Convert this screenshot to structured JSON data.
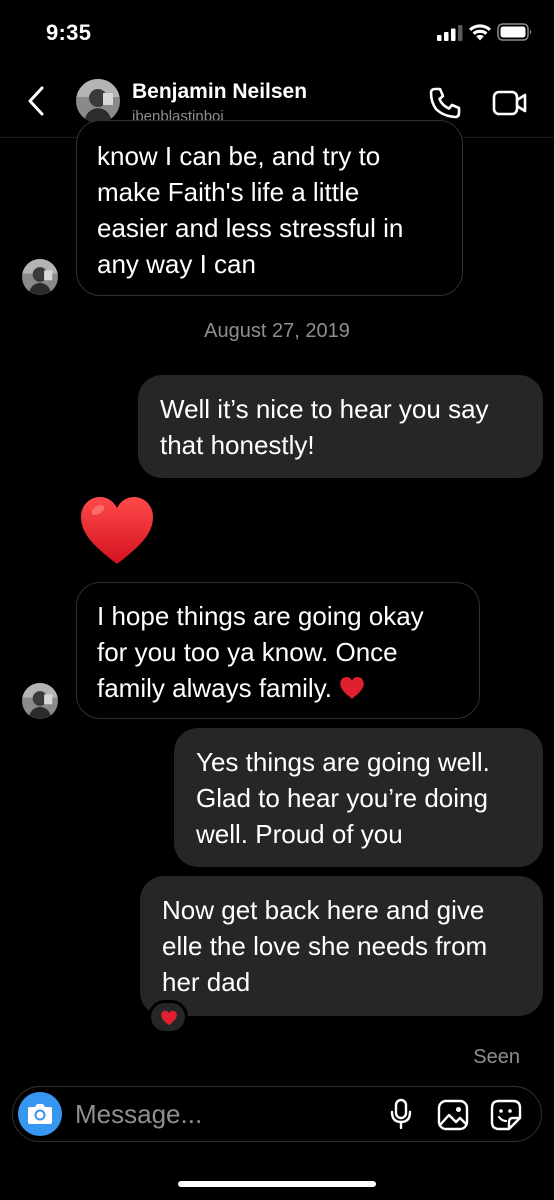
{
  "status_bar": {
    "time": "9:35"
  },
  "header": {
    "contact_name": "Benjamin Neilsen",
    "contact_handle": "ibenblastinboi"
  },
  "messages": [
    {
      "direction": "incoming",
      "text": "know I can be, and try to\nmake Faith's life a little\neasier and less stressful in\nany way I can"
    },
    {
      "direction": "incoming",
      "text": "I hope things are going okay\nfor you too ya know. Once\nfamily always family. ",
      "emoji": "heart"
    },
    {
      "direction": "outgoing",
      "text": "Well it’s nice to hear you say\nthat honestly!"
    },
    {
      "direction": "outgoing",
      "text": "Yes things are going well.\nGlad to hear you’re doing\nwell. Proud of you"
    },
    {
      "direction": "outgoing",
      "text": "Now get back here and give\nelle the love she needs from\nher dad",
      "reaction": "heart"
    }
  ],
  "date_separator": "August 27, 2019",
  "big_emoji": "heart",
  "seen_label": "Seen",
  "composer": {
    "placeholder": "Message..."
  },
  "colors": {
    "accent": "#3797f0",
    "outgoing_bubble": "#262628",
    "heart": "#e0202e"
  }
}
